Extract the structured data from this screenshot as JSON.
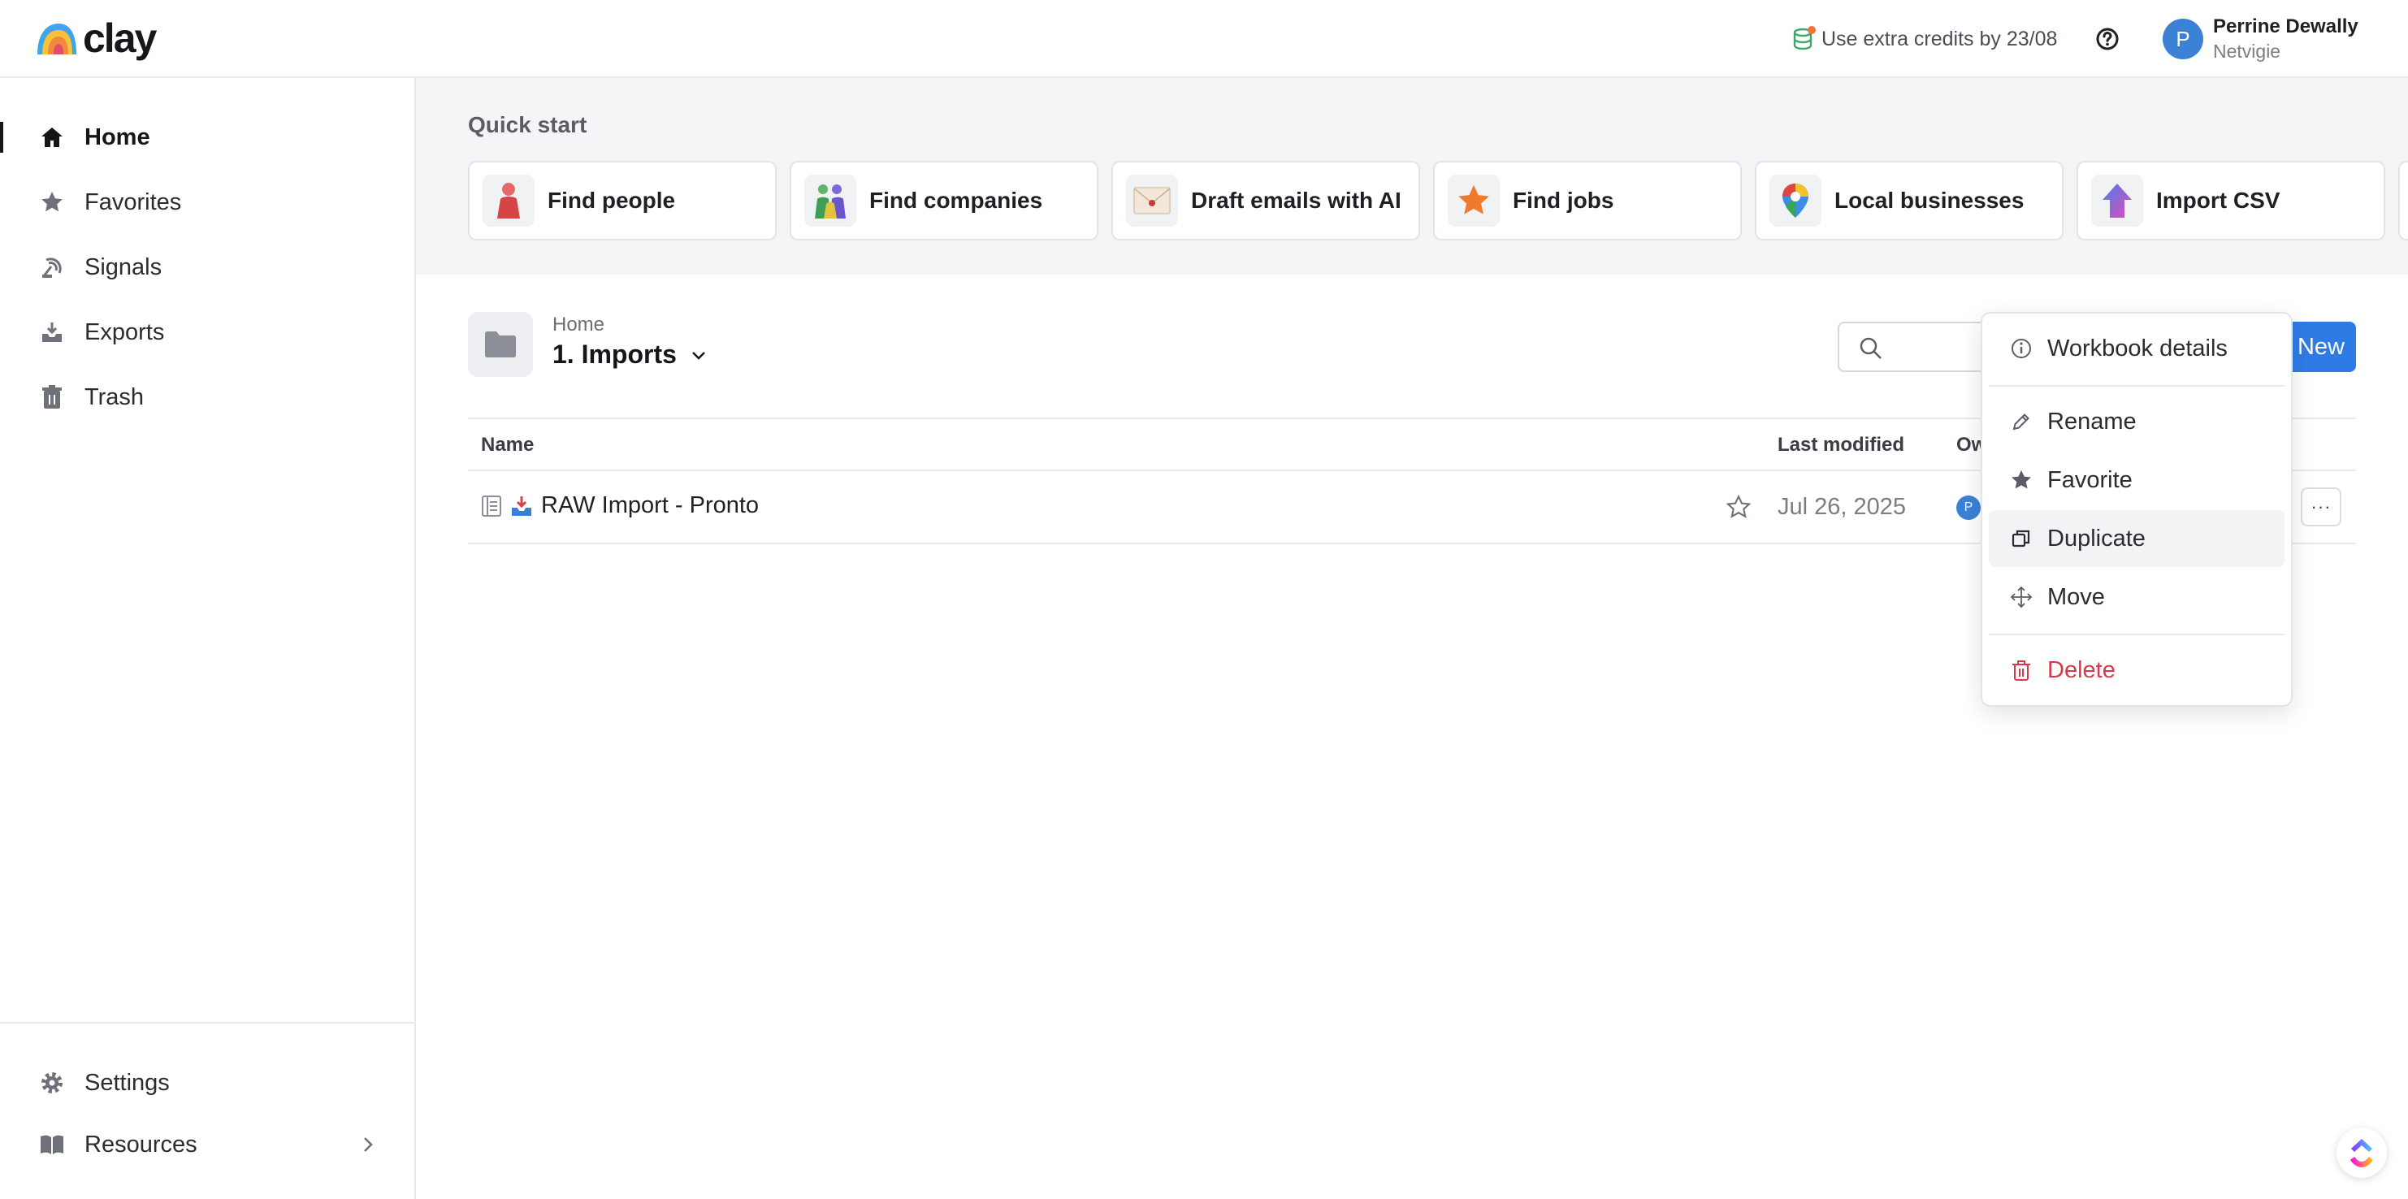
{
  "app": {
    "logo_text": "clay"
  },
  "header": {
    "credits_text": "Use extra credits by 23/08",
    "user": {
      "initial": "P",
      "name": "Perrine Dewally",
      "org": "Netvigie"
    }
  },
  "sidebar": {
    "items": [
      {
        "label": "Home",
        "icon": "home-icon",
        "active": true
      },
      {
        "label": "Favorites",
        "icon": "star-icon"
      },
      {
        "label": "Signals",
        "icon": "signal-icon"
      },
      {
        "label": "Exports",
        "icon": "export-tray-icon"
      },
      {
        "label": "Trash",
        "icon": "trash-icon"
      }
    ],
    "bottom": [
      {
        "label": "Settings",
        "icon": "gear-icon"
      },
      {
        "label": "Resources",
        "icon": "book-icon"
      }
    ]
  },
  "quick_start": {
    "title": "Quick start",
    "cards": [
      {
        "label": "Find people",
        "icon": "person-icon"
      },
      {
        "label": "Find companies",
        "icon": "people-group-icon"
      },
      {
        "label": "Draft emails with AI",
        "icon": "envelope-icon"
      },
      {
        "label": "Find jobs",
        "icon": "star-badge-icon"
      },
      {
        "label": "Local businesses",
        "icon": "map-pin-icon"
      },
      {
        "label": "Import CSV",
        "icon": "upload-arrow-icon"
      }
    ]
  },
  "folder": {
    "parent": "Home",
    "title": "1. Imports",
    "new_label": "New"
  },
  "table": {
    "columns": {
      "name": "Name",
      "modified": "Last modified",
      "owner": "Ow"
    },
    "rows": [
      {
        "name": "RAW Import - Pronto",
        "modified": "Jul 26, 2025",
        "owner_initial": "P",
        "more": "···"
      }
    ]
  },
  "context_menu": {
    "items": [
      {
        "label": "Workbook details",
        "icon": "info-icon"
      },
      {
        "label": "Rename",
        "icon": "pencil-icon"
      },
      {
        "label": "Favorite",
        "icon": "star-icon"
      },
      {
        "label": "Duplicate",
        "icon": "copy-icon",
        "hovered": true
      },
      {
        "label": "Move",
        "icon": "move-arrows-icon"
      },
      {
        "label": "Delete",
        "icon": "trash-icon",
        "danger": true
      }
    ]
  },
  "colors": {
    "accent": "#2f7be6",
    "danger": "#d63a4a",
    "avatar": "#3b82d6"
  }
}
